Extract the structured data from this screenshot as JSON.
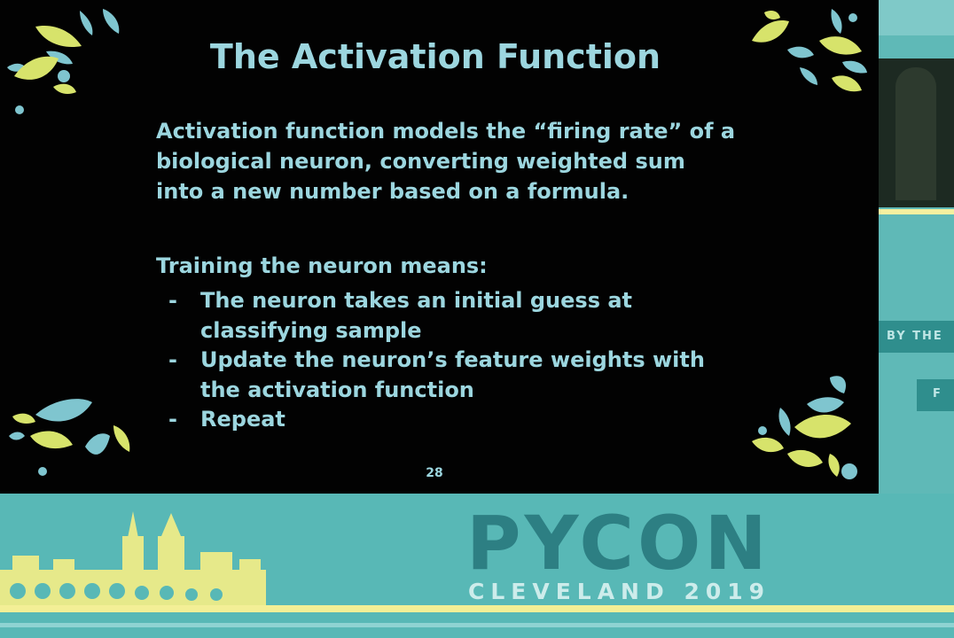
{
  "slide": {
    "title": "The Activation Function",
    "paragraph_lines": [
      "Activation function models the “firing rate” of a",
      "biological neuron, converting weighted sum",
      "into a new number based on a formula."
    ],
    "training_heading": "Training the neuron means:",
    "bullets": [
      {
        "dash": "-",
        "lines": [
          "The neuron takes an initial guess at",
          "classifying sample"
        ]
      },
      {
        "dash": "-",
        "lines": [
          "Update the neuron’s feature weights with",
          "the activation function"
        ]
      },
      {
        "dash": "-",
        "lines": [
          "Repeat"
        ]
      }
    ],
    "page_number": "28"
  },
  "stage": {
    "brand": "PYCON",
    "subtitle": "CLEVELAND 2019",
    "side_banner": "BY THE",
    "side_ribbon": "F"
  },
  "colors": {
    "slide_background": "#020202",
    "text_accent": "#9cd6df",
    "drop_teal": "#7fc5cf",
    "drop_yellow": "#d7e36b",
    "stage_teal": "#58b8b6",
    "logo_teal": "#2d7f83"
  }
}
